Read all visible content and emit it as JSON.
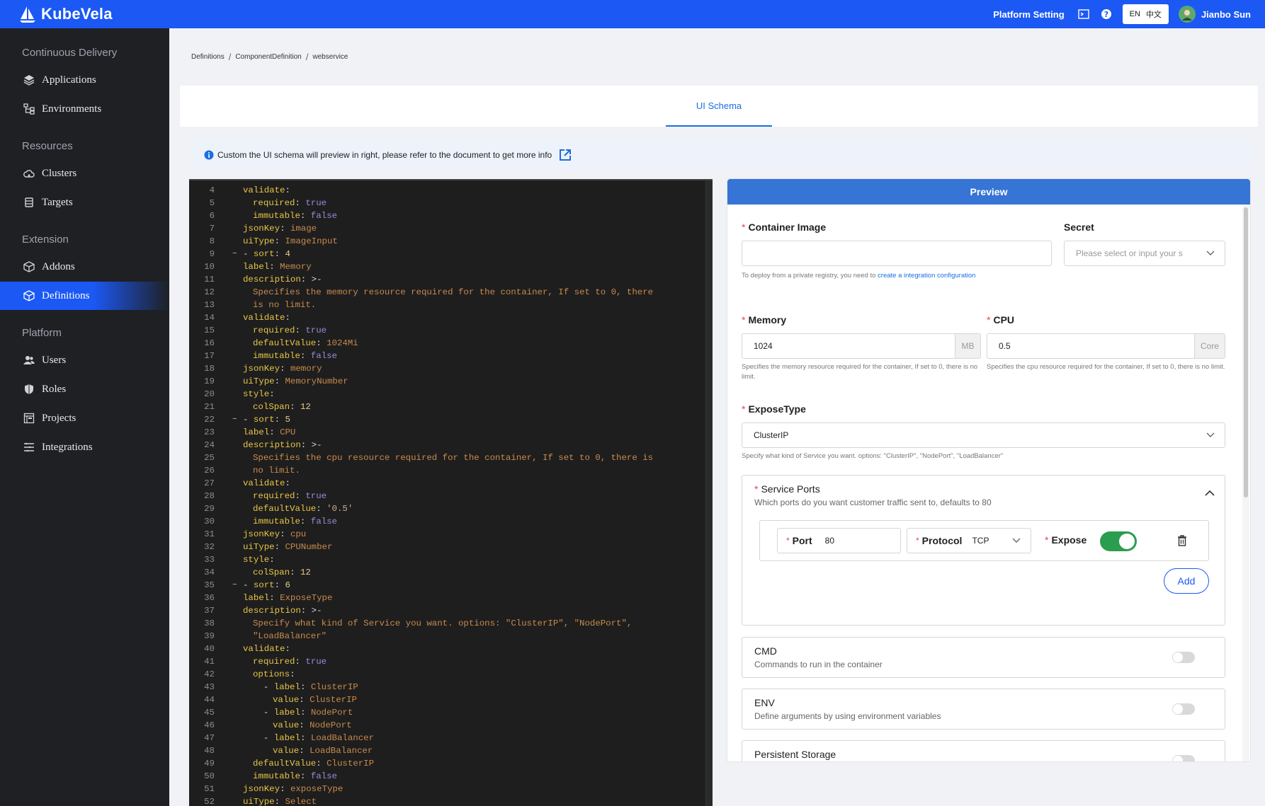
{
  "app": {
    "name": "KubeVela"
  },
  "topbar": {
    "platform_setting": "Platform Setting",
    "lang_en": "EN",
    "lang_zh": "中文",
    "user_name": "Jianbo Sun"
  },
  "sidebar": {
    "sections": [
      {
        "title": "Continuous Delivery",
        "items": [
          "Applications",
          "Environments"
        ]
      },
      {
        "title": "Resources",
        "items": [
          "Clusters",
          "Targets"
        ]
      },
      {
        "title": "Extension",
        "items": [
          "Addons",
          "Definitions"
        ]
      },
      {
        "title": "Platform",
        "items": [
          "Users",
          "Roles",
          "Projects",
          "Integrations"
        ]
      }
    ],
    "active": "Definitions"
  },
  "breadcrumb": [
    "Definitions",
    "ComponentDefinition",
    "webservice"
  ],
  "tabs": [
    {
      "label": "UI Schema",
      "active": true
    }
  ],
  "info": {
    "text": "Custom the UI schema will preview in right, please refer to the document to get more info"
  },
  "editor": {
    "lines": [
      {
        "n": "4",
        "fold": "",
        "indent": 1,
        "parts": [
          [
            "k",
            "validate"
          ],
          [
            "p",
            ":"
          ]
        ]
      },
      {
        "n": "5",
        "fold": "",
        "indent": 2,
        "parts": [
          [
            "k",
            "required"
          ],
          [
            "p",
            ": "
          ],
          [
            "vb",
            "true"
          ]
        ]
      },
      {
        "n": "6",
        "fold": "",
        "indent": 2,
        "parts": [
          [
            "k",
            "immutable"
          ],
          [
            "p",
            ": "
          ],
          [
            "vb",
            "false"
          ]
        ]
      },
      {
        "n": "7",
        "fold": "",
        "indent": 1,
        "parts": [
          [
            "k",
            "jsonKey"
          ],
          [
            "p",
            ": "
          ],
          [
            "v",
            "image"
          ]
        ]
      },
      {
        "n": "8",
        "fold": "",
        "indent": 1,
        "parts": [
          [
            "k",
            "uiType"
          ],
          [
            "p",
            ": "
          ],
          [
            "v",
            "ImageInput"
          ]
        ]
      },
      {
        "n": "9",
        "fold": "−",
        "indent": 0,
        "parts": [
          [
            "p",
            "- "
          ],
          [
            "k",
            "sort"
          ],
          [
            "p",
            ": "
          ],
          [
            "vn",
            "4"
          ]
        ]
      },
      {
        "n": "10",
        "fold": "",
        "indent": 1,
        "parts": [
          [
            "k",
            "label"
          ],
          [
            "p",
            ": "
          ],
          [
            "v",
            "Memory"
          ]
        ]
      },
      {
        "n": "11",
        "fold": "",
        "indent": 1,
        "parts": [
          [
            "k",
            "description"
          ],
          [
            "p",
            ": >-"
          ]
        ]
      },
      {
        "n": "12",
        "fold": "",
        "indent": 2,
        "parts": [
          [
            "v",
            "Specifies the memory resource required for the container, If set to 0, there"
          ]
        ]
      },
      {
        "n": "13",
        "fold": "",
        "indent": 2,
        "parts": [
          [
            "v",
            "is no limit."
          ]
        ]
      },
      {
        "n": "14",
        "fold": "",
        "indent": 1,
        "parts": [
          [
            "k",
            "validate"
          ],
          [
            "p",
            ":"
          ]
        ]
      },
      {
        "n": "15",
        "fold": "",
        "indent": 2,
        "parts": [
          [
            "k",
            "required"
          ],
          [
            "p",
            ": "
          ],
          [
            "vb",
            "true"
          ]
        ]
      },
      {
        "n": "16",
        "fold": "",
        "indent": 2,
        "parts": [
          [
            "k",
            "defaultValue"
          ],
          [
            "p",
            ": "
          ],
          [
            "v",
            "1024Mi"
          ]
        ]
      },
      {
        "n": "17",
        "fold": "",
        "indent": 2,
        "parts": [
          [
            "k",
            "immutable"
          ],
          [
            "p",
            ": "
          ],
          [
            "vb",
            "false"
          ]
        ]
      },
      {
        "n": "18",
        "fold": "",
        "indent": 1,
        "parts": [
          [
            "k",
            "jsonKey"
          ],
          [
            "p",
            ": "
          ],
          [
            "v",
            "memory"
          ]
        ]
      },
      {
        "n": "19",
        "fold": "",
        "indent": 1,
        "parts": [
          [
            "k",
            "uiType"
          ],
          [
            "p",
            ": "
          ],
          [
            "v",
            "MemoryNumber"
          ]
        ]
      },
      {
        "n": "20",
        "fold": "",
        "indent": 1,
        "parts": [
          [
            "k",
            "style"
          ],
          [
            "p",
            ":"
          ]
        ]
      },
      {
        "n": "21",
        "fold": "",
        "indent": 2,
        "parts": [
          [
            "k",
            "colSpan"
          ],
          [
            "p",
            ": "
          ],
          [
            "vn",
            "12"
          ]
        ]
      },
      {
        "n": "22",
        "fold": "−",
        "indent": 0,
        "parts": [
          [
            "p",
            "- "
          ],
          [
            "k",
            "sort"
          ],
          [
            "p",
            ": "
          ],
          [
            "vn",
            "5"
          ]
        ]
      },
      {
        "n": "23",
        "fold": "",
        "indent": 1,
        "parts": [
          [
            "k",
            "label"
          ],
          [
            "p",
            ": "
          ],
          [
            "v",
            "CPU"
          ]
        ]
      },
      {
        "n": "24",
        "fold": "",
        "indent": 1,
        "parts": [
          [
            "k",
            "description"
          ],
          [
            "p",
            ": >-"
          ]
        ]
      },
      {
        "n": "25",
        "fold": "",
        "indent": 2,
        "parts": [
          [
            "v",
            "Specifies the cpu resource required for the container, If set to 0, there is"
          ]
        ]
      },
      {
        "n": "26",
        "fold": "",
        "indent": 2,
        "parts": [
          [
            "v",
            "no limit."
          ]
        ]
      },
      {
        "n": "27",
        "fold": "",
        "indent": 1,
        "parts": [
          [
            "k",
            "validate"
          ],
          [
            "p",
            ":"
          ]
        ]
      },
      {
        "n": "28",
        "fold": "",
        "indent": 2,
        "parts": [
          [
            "k",
            "required"
          ],
          [
            "p",
            ": "
          ],
          [
            "vb",
            "true"
          ]
        ]
      },
      {
        "n": "29",
        "fold": "",
        "indent": 2,
        "parts": [
          [
            "k",
            "defaultValue"
          ],
          [
            "p",
            ": "
          ],
          [
            "vs",
            "'0.5'"
          ]
        ]
      },
      {
        "n": "30",
        "fold": "",
        "indent": 2,
        "parts": [
          [
            "k",
            "immutable"
          ],
          [
            "p",
            ": "
          ],
          [
            "vb",
            "false"
          ]
        ]
      },
      {
        "n": "31",
        "fold": "",
        "indent": 1,
        "parts": [
          [
            "k",
            "jsonKey"
          ],
          [
            "p",
            ": "
          ],
          [
            "v",
            "cpu"
          ]
        ]
      },
      {
        "n": "32",
        "fold": "",
        "indent": 1,
        "parts": [
          [
            "k",
            "uiType"
          ],
          [
            "p",
            ": "
          ],
          [
            "v",
            "CPUNumber"
          ]
        ]
      },
      {
        "n": "33",
        "fold": "",
        "indent": 1,
        "parts": [
          [
            "k",
            "style"
          ],
          [
            "p",
            ":"
          ]
        ]
      },
      {
        "n": "34",
        "fold": "",
        "indent": 2,
        "parts": [
          [
            "k",
            "colSpan"
          ],
          [
            "p",
            ": "
          ],
          [
            "vn",
            "12"
          ]
        ]
      },
      {
        "n": "35",
        "fold": "−",
        "indent": 0,
        "parts": [
          [
            "p",
            "- "
          ],
          [
            "k",
            "sort"
          ],
          [
            "p",
            ": "
          ],
          [
            "vn",
            "6"
          ]
        ]
      },
      {
        "n": "36",
        "fold": "",
        "indent": 1,
        "parts": [
          [
            "k",
            "label"
          ],
          [
            "p",
            ": "
          ],
          [
            "v",
            "ExposeType"
          ]
        ]
      },
      {
        "n": "37",
        "fold": "",
        "indent": 1,
        "parts": [
          [
            "k",
            "description"
          ],
          [
            "p",
            ": >-"
          ]
        ]
      },
      {
        "n": "38",
        "fold": "",
        "indent": 2,
        "parts": [
          [
            "v",
            "Specify what kind of Service you want. options: \"ClusterIP\", \"NodePort\","
          ]
        ]
      },
      {
        "n": "39",
        "fold": "",
        "indent": 2,
        "parts": [
          [
            "v",
            "\"LoadBalancer\""
          ]
        ]
      },
      {
        "n": "40",
        "fold": "",
        "indent": 1,
        "parts": [
          [
            "k",
            "validate"
          ],
          [
            "p",
            ":"
          ]
        ]
      },
      {
        "n": "41",
        "fold": "",
        "indent": 2,
        "parts": [
          [
            "k",
            "required"
          ],
          [
            "p",
            ": "
          ],
          [
            "vb",
            "true"
          ]
        ]
      },
      {
        "n": "42",
        "fold": "",
        "indent": 2,
        "parts": [
          [
            "k",
            "options"
          ],
          [
            "p",
            ":"
          ]
        ]
      },
      {
        "n": "43",
        "fold": "",
        "indent": 2,
        "parts": [
          [
            "p",
            "  - "
          ],
          [
            "k",
            "label"
          ],
          [
            "p",
            ": "
          ],
          [
            "v",
            "ClusterIP"
          ]
        ]
      },
      {
        "n": "44",
        "fold": "",
        "indent": 3,
        "parts": [
          [
            "k",
            "value"
          ],
          [
            "p",
            ": "
          ],
          [
            "v",
            "ClusterIP"
          ]
        ]
      },
      {
        "n": "45",
        "fold": "",
        "indent": 2,
        "parts": [
          [
            "p",
            "  - "
          ],
          [
            "k",
            "label"
          ],
          [
            "p",
            ": "
          ],
          [
            "v",
            "NodePort"
          ]
        ]
      },
      {
        "n": "46",
        "fold": "",
        "indent": 3,
        "parts": [
          [
            "k",
            "value"
          ],
          [
            "p",
            ": "
          ],
          [
            "v",
            "NodePort"
          ]
        ]
      },
      {
        "n": "47",
        "fold": "",
        "indent": 2,
        "parts": [
          [
            "p",
            "  - "
          ],
          [
            "k",
            "label"
          ],
          [
            "p",
            ": "
          ],
          [
            "v",
            "LoadBalancer"
          ]
        ]
      },
      {
        "n": "48",
        "fold": "",
        "indent": 3,
        "parts": [
          [
            "k",
            "value"
          ],
          [
            "p",
            ": "
          ],
          [
            "v",
            "LoadBalancer"
          ]
        ]
      },
      {
        "n": "49",
        "fold": "",
        "indent": 2,
        "parts": [
          [
            "k",
            "defaultValue"
          ],
          [
            "p",
            ": "
          ],
          [
            "v",
            "ClusterIP"
          ]
        ]
      },
      {
        "n": "50",
        "fold": "",
        "indent": 2,
        "parts": [
          [
            "k",
            "immutable"
          ],
          [
            "p",
            ": "
          ],
          [
            "vb",
            "false"
          ]
        ]
      },
      {
        "n": "51",
        "fold": "",
        "indent": 1,
        "parts": [
          [
            "k",
            "jsonKey"
          ],
          [
            "p",
            ": "
          ],
          [
            "v",
            "exposeType"
          ]
        ]
      },
      {
        "n": "52",
        "fold": "",
        "indent": 1,
        "parts": [
          [
            "k",
            "uiType"
          ],
          [
            "p",
            ": "
          ],
          [
            "v",
            "Select"
          ]
        ]
      }
    ]
  },
  "preview": {
    "title": "Preview",
    "container_image": {
      "label": "Container Image",
      "value": "",
      "help_prefix": "To deploy from a private registry, you need to ",
      "help_link": "create a integration configuration"
    },
    "secret": {
      "label": "Secret",
      "placeholder": "Please select or input your s"
    },
    "memory": {
      "label": "Memory",
      "value": "1024",
      "unit": "MB",
      "help": "Specifies the memory resource required for the container, If set to 0, there is no limit."
    },
    "cpu": {
      "label": "CPU",
      "value": "0.5",
      "unit": "Core",
      "help": "Specifies the cpu resource required for the container, If set to 0, there is no limit."
    },
    "expose_type": {
      "label": "ExposeType",
      "value": "ClusterIP",
      "help": "Specify what kind of Service you want. options: \"ClusterIP\", \"NodePort\", \"LoadBalancer\""
    },
    "service_ports": {
      "title": "Service Ports",
      "desc": "Which ports do you want customer traffic sent to, defaults to 80",
      "port_label": "Port",
      "port_value": "80",
      "protocol_label": "Protocol",
      "protocol_value": "TCP",
      "expose_label": "Expose",
      "expose_on": true,
      "add_label": "Add"
    },
    "cmd": {
      "title": "CMD",
      "desc": "Commands to run in the container"
    },
    "env": {
      "title": "ENV",
      "desc": "Define arguments by using environment variables"
    },
    "storage": {
      "title": "Persistent Storage"
    }
  },
  "colors": {
    "brand": "#1b58f4",
    "sidebar_bg": "#1f2024",
    "editor_bg": "#1e1e1e",
    "toggle_on": "#2a9d4e"
  }
}
